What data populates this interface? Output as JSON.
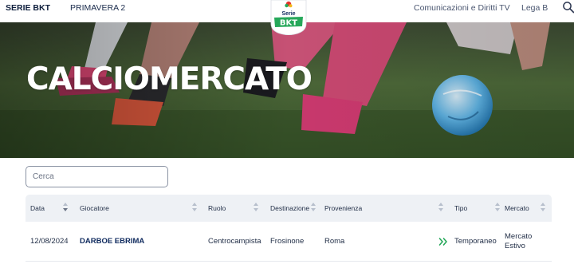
{
  "nav": {
    "brand": "SERIE BKT",
    "primavera": "PRIMAVERA 2",
    "communications": "Comunicazioni e Diritti TV",
    "lega": "Lega B",
    "logo_text_top": "Serie",
    "logo_text_main": "BKT"
  },
  "hero": {
    "title": "CALCIOMERCATO"
  },
  "search": {
    "placeholder": "Cerca",
    "value": ""
  },
  "table": {
    "columns": [
      "Data",
      "Giocatore",
      "Ruolo",
      "Destinazione",
      "Provenienza",
      "Tipo",
      "Mercato"
    ],
    "rows": [
      {
        "data": "12/08/2024",
        "giocatore": "DARBOE EBRIMA",
        "ruolo": "Centrocampista",
        "destinazione": "Frosinone",
        "provenienza": "Roma",
        "tipo": "Temporaneo",
        "mercato": "Mercato Estivo"
      }
    ]
  },
  "icons": {
    "search": "search-icon",
    "sort": "sort-icon",
    "transfer": "double-chevron-right-icon"
  },
  "colors": {
    "accent_green": "#26a85a",
    "navy": "#0f2a5e",
    "header_bg": "#eef1f5"
  }
}
